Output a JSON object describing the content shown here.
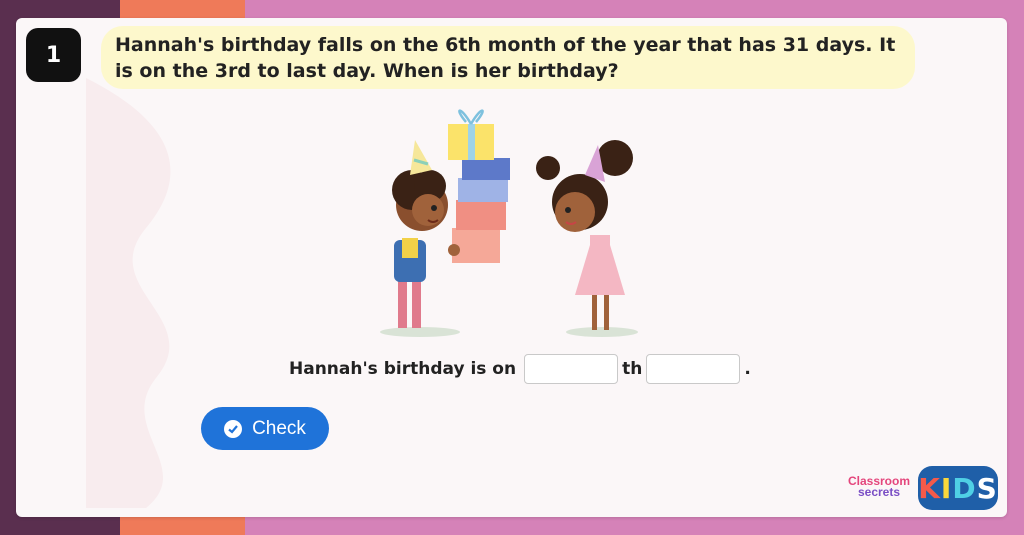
{
  "question": {
    "number": "1",
    "text": "Hannah's birthday falls on the 6th month of the year that has 31 days. It is on the 3rd to last day. When is her birthday?"
  },
  "answer": {
    "prefix": "Hannah's birthday is on",
    "day_value": "",
    "suffix_th": "th",
    "month_value": "",
    "end": "."
  },
  "check_button": {
    "label": "Check"
  },
  "branding": {
    "classroom_line1": "Classroom",
    "classroom_line2": "secrets",
    "kids": [
      "K",
      "I",
      "D",
      "S"
    ]
  },
  "colors": {
    "check_button": "#1f73d9",
    "question_bg": "#fdf8cc",
    "number_badge": "#111111"
  }
}
